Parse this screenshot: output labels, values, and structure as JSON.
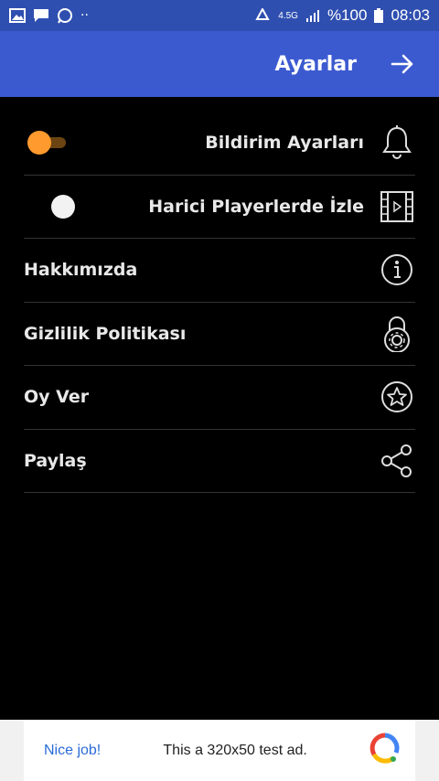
{
  "status_bar": {
    "network": "4.5G",
    "battery": "%100",
    "time": "08:03"
  },
  "app_bar": {
    "title": "Ayarlar"
  },
  "settings": {
    "items": [
      {
        "label": "Bildirim Ayarları",
        "icon": "bell-icon"
      },
      {
        "label": "Harici Playerlerde İzle",
        "icon": "film-play-icon"
      },
      {
        "label": "Hakkımızda",
        "icon": "info-icon"
      },
      {
        "label": "Gizlilik Politikası",
        "icon": "lock-gear-icon"
      },
      {
        "label": "Oy Ver",
        "icon": "star-icon"
      },
      {
        "label": "Paylaş",
        "icon": "share-icon"
      }
    ]
  },
  "ad": {
    "nice": "Nice job!",
    "text": "This a 320x50 test ad."
  },
  "colors": {
    "status_bar": "#2f4fb0",
    "app_bar": "#3c5ad0",
    "accent": "#ff9a2e"
  }
}
